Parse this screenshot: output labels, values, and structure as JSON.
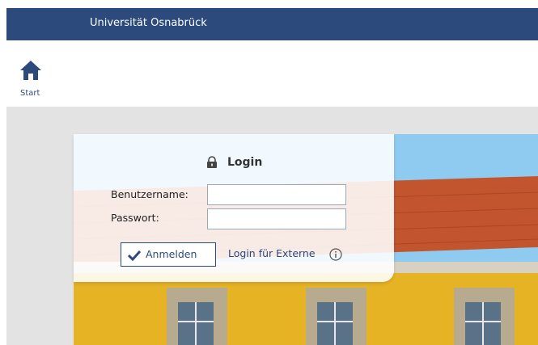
{
  "header": {
    "brand": "Universität Osnabrück",
    "bar_color": "#2c4a7c"
  },
  "nav": {
    "start_label": "Start",
    "start_icon": "home-icon"
  },
  "login": {
    "title": "Login",
    "title_icon": "lock-icon",
    "username_label": "Benutzername:",
    "username_value": "",
    "password_label": "Passwort:",
    "password_value": "",
    "submit_label": "Anmelden",
    "submit_icon": "checkmark-icon",
    "extern_link": "Login für Externe",
    "extern_info_icon": "info-icon"
  },
  "colors": {
    "accent": "#2c4a7c",
    "content_bg": "#e3e3e3"
  }
}
